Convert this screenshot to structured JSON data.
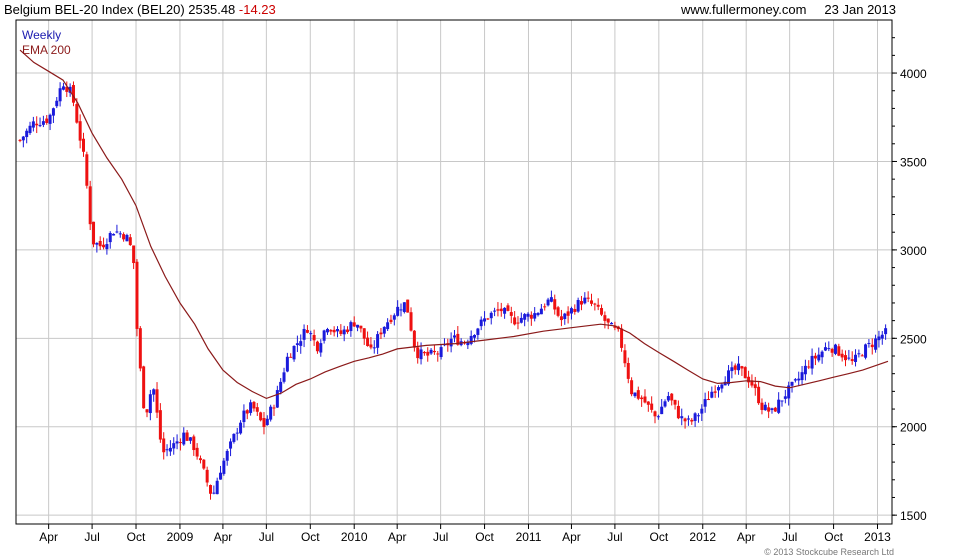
{
  "header": {
    "title": "Belgium BEL-20 Index (BEL20)",
    "last": "2535.48",
    "change": "-14.23",
    "site": "www.fullermoney.com",
    "date": "23 Jan 2013"
  },
  "legend": {
    "period": "Weekly",
    "ma": "EMA 200"
  },
  "copyright": "© 2013 Stockcube Research Ltd",
  "colors": {
    "up": "#1a1adb",
    "down": "#ee1111",
    "ema": "#8b1a1a",
    "grid": "#c8c8c8",
    "frame": "#000000"
  },
  "chart_data": {
    "type": "line",
    "title": "Belgium BEL-20 Index (BEL20)",
    "frequency": "weekly candlesticks",
    "x_start": "2008-02-01",
    "x_end": "2013-01-23",
    "ylim": [
      1450,
      4300
    ],
    "yticks": [
      1500,
      2000,
      2500,
      3000,
      3500,
      4000
    ],
    "xticks": [
      {
        "label": "Apr",
        "date": "2008-04-01"
      },
      {
        "label": "Jul",
        "date": "2008-07-01"
      },
      {
        "label": "Oct",
        "date": "2008-10-01"
      },
      {
        "label": "2009",
        "date": "2009-01-01"
      },
      {
        "label": "Apr",
        "date": "2009-04-01"
      },
      {
        "label": "Jul",
        "date": "2009-07-01"
      },
      {
        "label": "Oct",
        "date": "2009-10-01"
      },
      {
        "label": "2010",
        "date": "2010-01-01"
      },
      {
        "label": "Apr",
        "date": "2010-04-01"
      },
      {
        "label": "Jul",
        "date": "2010-07-01"
      },
      {
        "label": "Oct",
        "date": "2010-10-01"
      },
      {
        "label": "2011",
        "date": "2011-01-01"
      },
      {
        "label": "Apr",
        "date": "2011-04-01"
      },
      {
        "label": "Jul",
        "date": "2011-07-01"
      },
      {
        "label": "Oct",
        "date": "2011-10-01"
      },
      {
        "label": "2012",
        "date": "2012-01-01"
      },
      {
        "label": "Apr",
        "date": "2012-04-01"
      },
      {
        "label": "Jul",
        "date": "2012-07-01"
      },
      {
        "label": "Oct",
        "date": "2012-10-01"
      },
      {
        "label": "2013",
        "date": "2013-01-01"
      }
    ],
    "grid": true,
    "series": [
      {
        "name": "Weekly",
        "kind": "candlestick",
        "points": [
          [
            "2008-02-01",
            3620
          ],
          [
            "2008-03-01",
            3720
          ],
          [
            "2008-04-01",
            3740
          ],
          [
            "2008-05-01",
            3950
          ],
          [
            "2008-05-20",
            3880
          ],
          [
            "2008-06-15",
            3500
          ],
          [
            "2008-07-01",
            3050
          ],
          [
            "2008-07-20",
            3020
          ],
          [
            "2008-08-15",
            3110
          ],
          [
            "2008-09-10",
            3080
          ],
          [
            "2008-09-25",
            2980
          ],
          [
            "2008-10-05",
            2450
          ],
          [
            "2008-10-20",
            2050
          ],
          [
            "2008-11-05",
            2250
          ],
          [
            "2008-11-25",
            1850
          ],
          [
            "2008-12-20",
            1900
          ],
          [
            "2009-01-10",
            1960
          ],
          [
            "2009-02-01",
            1880
          ],
          [
            "2009-02-20",
            1740
          ],
          [
            "2009-03-10",
            1600
          ],
          [
            "2009-03-25",
            1750
          ],
          [
            "2009-04-15",
            1880
          ],
          [
            "2009-05-10",
            2050
          ],
          [
            "2009-06-01",
            2120
          ],
          [
            "2009-06-25",
            2000
          ],
          [
            "2009-07-20",
            2150
          ],
          [
            "2009-08-15",
            2400
          ],
          [
            "2009-09-05",
            2480
          ],
          [
            "2009-09-25",
            2560
          ],
          [
            "2009-10-15",
            2450
          ],
          [
            "2009-11-05",
            2580
          ],
          [
            "2009-12-01",
            2520
          ],
          [
            "2010-01-05",
            2600
          ],
          [
            "2010-02-05",
            2420
          ],
          [
            "2010-03-01",
            2560
          ],
          [
            "2010-04-05",
            2680
          ],
          [
            "2010-04-20",
            2700
          ],
          [
            "2010-05-10",
            2420
          ],
          [
            "2010-06-01",
            2400
          ],
          [
            "2010-07-01",
            2420
          ],
          [
            "2010-07-25",
            2500
          ],
          [
            "2010-08-20",
            2480
          ],
          [
            "2010-09-15",
            2560
          ],
          [
            "2010-10-10",
            2630
          ],
          [
            "2010-11-05",
            2660
          ],
          [
            "2010-11-30",
            2600
          ],
          [
            "2010-12-20",
            2620
          ],
          [
            "2011-01-15",
            2640
          ],
          [
            "2011-02-15",
            2720
          ],
          [
            "2011-03-10",
            2600
          ],
          [
            "2011-04-01",
            2660
          ],
          [
            "2011-04-25",
            2720
          ],
          [
            "2011-05-20",
            2680
          ],
          [
            "2011-06-15",
            2580
          ],
          [
            "2011-07-10",
            2520
          ],
          [
            "2011-08-05",
            2200
          ],
          [
            "2011-08-30",
            2150
          ],
          [
            "2011-09-25",
            2050
          ],
          [
            "2011-10-20",
            2180
          ],
          [
            "2011-11-15",
            2050
          ],
          [
            "2011-12-05",
            2020
          ],
          [
            "2011-12-25",
            2080
          ],
          [
            "2012-01-20",
            2200
          ],
          [
            "2012-02-15",
            2280
          ],
          [
            "2012-03-15",
            2330
          ],
          [
            "2012-04-10",
            2260
          ],
          [
            "2012-05-05",
            2110
          ],
          [
            "2012-05-25",
            2080
          ],
          [
            "2012-06-20",
            2180
          ],
          [
            "2012-07-15",
            2250
          ],
          [
            "2012-08-10",
            2360
          ],
          [
            "2012-09-01",
            2410
          ],
          [
            "2012-09-20",
            2460
          ],
          [
            "2012-10-15",
            2420
          ],
          [
            "2012-11-10",
            2360
          ],
          [
            "2012-12-01",
            2430
          ],
          [
            "2012-12-20",
            2470
          ],
          [
            "2013-01-10",
            2520
          ],
          [
            "2013-01-23",
            2535
          ]
        ]
      },
      {
        "name": "EMA 200",
        "kind": "line",
        "points": [
          [
            "2008-02-01",
            4130
          ],
          [
            "2008-03-01",
            4060
          ],
          [
            "2008-04-01",
            4010
          ],
          [
            "2008-05-01",
            3960
          ],
          [
            "2008-06-01",
            3830
          ],
          [
            "2008-07-01",
            3660
          ],
          [
            "2008-08-01",
            3520
          ],
          [
            "2008-09-01",
            3400
          ],
          [
            "2008-10-01",
            3250
          ],
          [
            "2008-11-01",
            3020
          ],
          [
            "2008-12-01",
            2850
          ],
          [
            "2009-01-01",
            2700
          ],
          [
            "2009-02-01",
            2580
          ],
          [
            "2009-03-01",
            2440
          ],
          [
            "2009-04-01",
            2320
          ],
          [
            "2009-05-01",
            2250
          ],
          [
            "2009-06-01",
            2200
          ],
          [
            "2009-07-01",
            2160
          ],
          [
            "2009-08-01",
            2190
          ],
          [
            "2009-09-01",
            2240
          ],
          [
            "2009-10-01",
            2270
          ],
          [
            "2009-11-01",
            2310
          ],
          [
            "2009-12-01",
            2340
          ],
          [
            "2010-01-01",
            2370
          ],
          [
            "2010-02-01",
            2390
          ],
          [
            "2010-03-01",
            2410
          ],
          [
            "2010-04-01",
            2440
          ],
          [
            "2010-06-01",
            2460
          ],
          [
            "2010-08-01",
            2470
          ],
          [
            "2010-10-01",
            2490
          ],
          [
            "2010-12-01",
            2510
          ],
          [
            "2011-02-01",
            2540
          ],
          [
            "2011-04-01",
            2560
          ],
          [
            "2011-06-01",
            2580
          ],
          [
            "2011-07-01",
            2570
          ],
          [
            "2011-08-01",
            2530
          ],
          [
            "2011-09-01",
            2470
          ],
          [
            "2011-10-01",
            2420
          ],
          [
            "2011-11-01",
            2370
          ],
          [
            "2011-12-01",
            2320
          ],
          [
            "2012-01-01",
            2270
          ],
          [
            "2012-02-01",
            2245
          ],
          [
            "2012-03-01",
            2250
          ],
          [
            "2012-04-01",
            2260
          ],
          [
            "2012-05-01",
            2255
          ],
          [
            "2012-06-01",
            2230
          ],
          [
            "2012-07-01",
            2220
          ],
          [
            "2012-08-01",
            2240
          ],
          [
            "2012-09-01",
            2260
          ],
          [
            "2012-10-01",
            2280
          ],
          [
            "2012-11-01",
            2300
          ],
          [
            "2012-12-01",
            2320
          ],
          [
            "2013-01-23",
            2370
          ]
        ]
      }
    ]
  }
}
